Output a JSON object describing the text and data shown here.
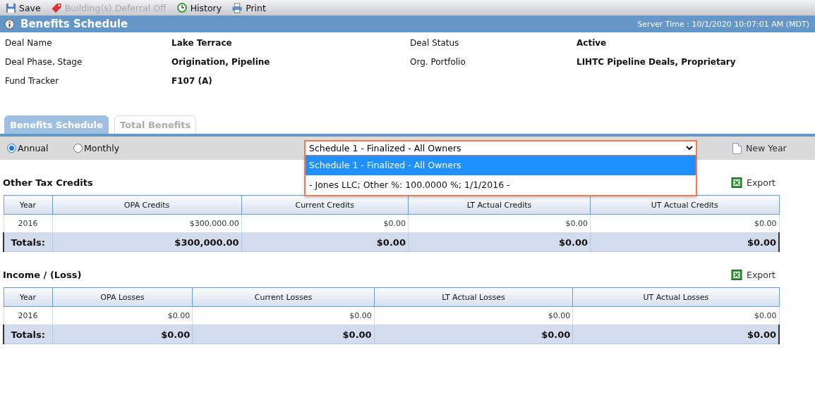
{
  "toolbar": [
    {
      "kind": "save",
      "label": "Save",
      "disabled": false
    },
    {
      "kind": "tag",
      "label": "Building(s) Deferral Off",
      "disabled": true
    },
    {
      "kind": "history",
      "label": "History",
      "disabled": false
    },
    {
      "kind": "print",
      "label": "Print",
      "disabled": false
    }
  ],
  "header": {
    "title": "Benefits Schedule",
    "server_time": "Server Time : 10/1/2020 10:07:01 AM (MDT)"
  },
  "details": [
    {
      "label": "Deal Name",
      "value": "Lake Terrace"
    },
    {
      "label": "Deal Status",
      "value": "Active"
    },
    {
      "label": "Deal Phase, Stage",
      "value": "Origination, Pipeline"
    },
    {
      "label": "Org. Portfolio",
      "value": "LIHTC Pipeline Deals, Proprietary"
    },
    {
      "label": "Fund Tracker",
      "value": "F107 (A)"
    }
  ],
  "tabs": [
    {
      "label": "Benefits Schedule",
      "selected": true
    },
    {
      "label": "Total Benefits",
      "selected": false
    }
  ],
  "period": [
    {
      "label": "Annual",
      "selected": true
    },
    {
      "label": "Monthly",
      "selected": false
    }
  ],
  "schedule_select": {
    "value": "Schedule 1 - Finalized - All Owners",
    "expanded": true,
    "options": [
      {
        "label": "Schedule 1 - Finalized - All Owners",
        "selected": true
      },
      {
        "label": "- Jones LLC; Other %: 100.0000 %; 1/1/2016 -",
        "selected": false
      }
    ]
  },
  "new_year_button": "New Year",
  "sections": [
    {
      "title": "Other Tax Credits",
      "export": "Export",
      "columns": [
        "Year",
        "OPA Credits",
        "Current Credits",
        "LT Actual Credits",
        "UT Actual Credits"
      ],
      "rows": [
        [
          "2016",
          "$300,000.00",
          "$0.00",
          "$0.00",
          "$0.00"
        ]
      ],
      "totals": [
        "Totals:",
        "$300,000.00",
        "$0.00",
        "$0.00",
        "$0.00"
      ]
    },
    {
      "title": "Income / (Loss)",
      "export": "Export",
      "columns": [
        "Year",
        "OPA Losses",
        "Current Losses",
        "LT Actual Losses",
        "UT Actual Losses"
      ],
      "rows": [
        [
          "2016",
          "$0.00",
          "$0.00",
          "$0.00",
          "$0.00"
        ]
      ],
      "totals": [
        "Totals:",
        "$0.00",
        "$0.00",
        "$0.00",
        "$0.00"
      ]
    }
  ]
}
